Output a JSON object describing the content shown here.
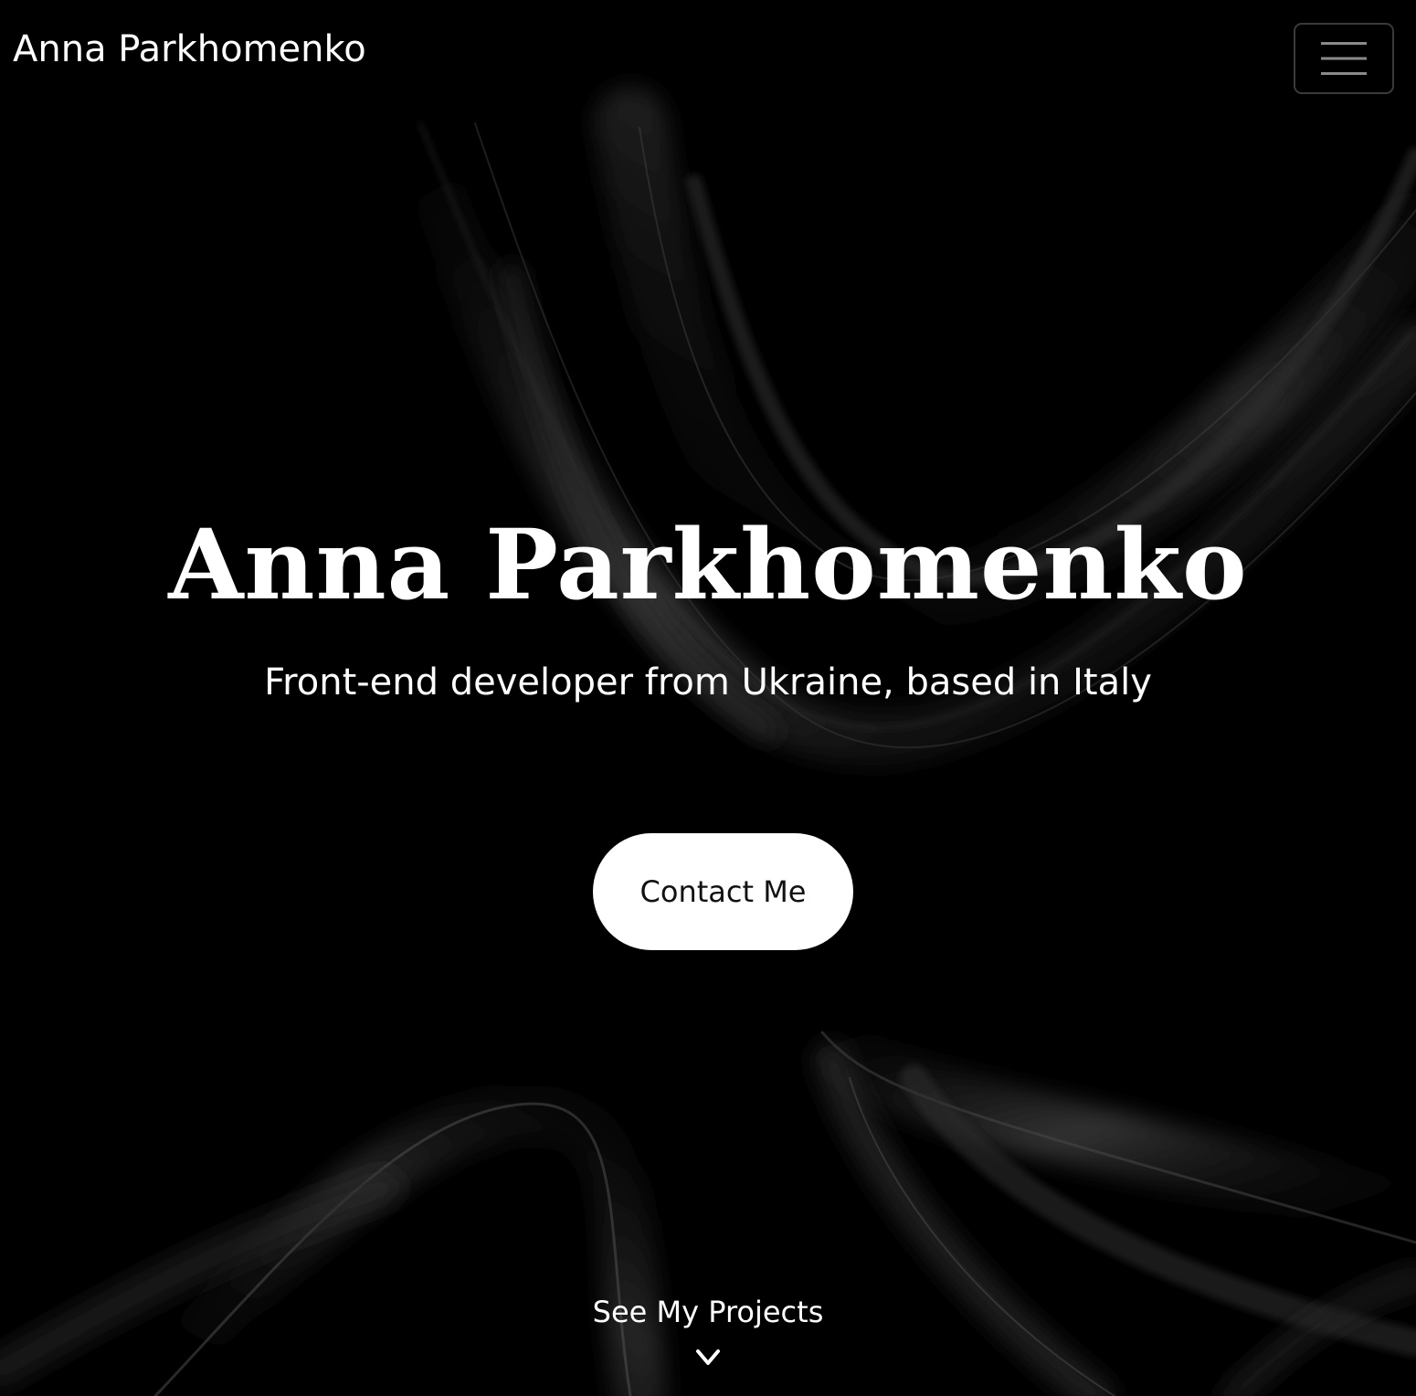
{
  "navbar": {
    "brand": "Anna Parkhomenko",
    "menu_icon": "hamburger-menu-icon"
  },
  "hero": {
    "title": "Anna Parkhomenko",
    "subtitle": "Front-end developer from Ukraine, based in Italy",
    "contact_label": "Contact Me"
  },
  "scroll_cue": {
    "label": "See My Projects",
    "icon": "chevron-down-icon"
  },
  "colors": {
    "background": "#000000",
    "text": "#ffffff",
    "button_bg": "#ffffff",
    "button_text": "#111111",
    "menu_border": "#3a3a3a"
  }
}
